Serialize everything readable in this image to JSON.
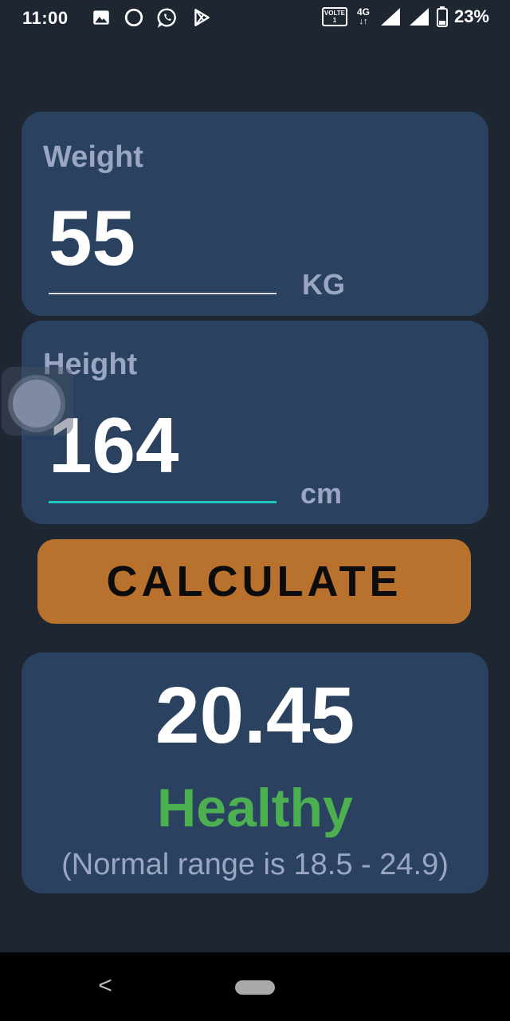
{
  "status_bar": {
    "time": "11:00",
    "left_icons": [
      "image-icon",
      "circle-icon",
      "whatsapp-icon",
      "play-store-icon"
    ],
    "volte_label": "VOLTE",
    "volte_sub": "1",
    "network_type": "4G",
    "battery_percent": "23%"
  },
  "weight": {
    "label": "Weight",
    "value": "55",
    "unit": "KG"
  },
  "height": {
    "label": "Height",
    "value": "164",
    "unit": "cm"
  },
  "calculate_button": {
    "label": "CALCULATE"
  },
  "result": {
    "bmi": "20.45",
    "status": "Healthy",
    "range_text": "(Normal range is 18.5 - 24.9)"
  },
  "nav_bar": {
    "back_glyph": "<"
  },
  "colors": {
    "background": "#1e2632",
    "card": "#2a4260",
    "label": "#9aa6c2",
    "accent_underline": "#1fc8c0",
    "button": "#b8722e",
    "healthy": "#4caf50"
  }
}
